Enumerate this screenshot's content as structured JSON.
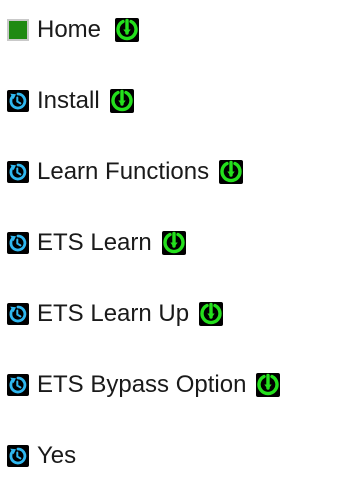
{
  "nav": {
    "items": [
      {
        "label": "Home",
        "lead_icon": "home-square-icon",
        "has_down_arrow": true
      },
      {
        "label": "Install",
        "lead_icon": "cycle-arrow-icon",
        "has_down_arrow": true
      },
      {
        "label": "Learn Functions",
        "lead_icon": "cycle-arrow-icon",
        "has_down_arrow": true
      },
      {
        "label": "ETS Learn",
        "lead_icon": "cycle-arrow-icon",
        "has_down_arrow": true
      },
      {
        "label": "ETS Learn Up",
        "lead_icon": "cycle-arrow-icon",
        "has_down_arrow": true
      },
      {
        "label": "ETS Bypass Option",
        "lead_icon": "cycle-arrow-icon",
        "has_down_arrow": true
      },
      {
        "label": "Yes",
        "lead_icon": "cycle-arrow-icon",
        "has_down_arrow": false
      }
    ]
  },
  "colors": {
    "home_square": "#1f8a12",
    "cycle_icon": "#2fb8f0",
    "down_arrow": "#24e01c",
    "icon_background": "#000000"
  }
}
